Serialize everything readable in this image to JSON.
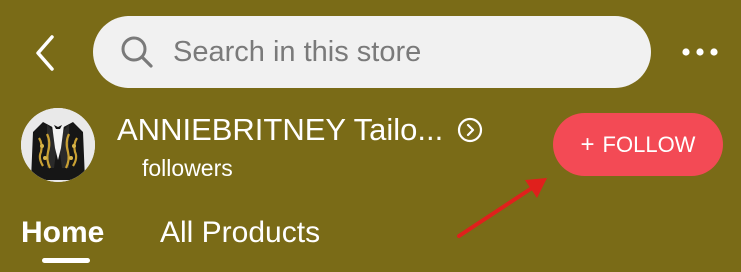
{
  "colors": {
    "background": "#7a6b17",
    "search_bg": "#f1f1f1",
    "follow_button": "#f34a55",
    "annotation_arrow": "#e0201c",
    "text": "#ffffff"
  },
  "header": {
    "back_icon": "chevron-left-icon",
    "search": {
      "placeholder": "Search in this store",
      "value": "",
      "icon": "search-icon"
    },
    "more_icon": "more-dots-icon"
  },
  "store": {
    "avatar_icon": "tuxedo-jacket-avatar",
    "name": "ANNIEBRITNEY Tailo...",
    "name_arrow_icon": "circle-chevron-right-icon",
    "followers_label": "followers",
    "follow_button": {
      "plus": "+",
      "label": "FOLLOW"
    }
  },
  "tabs": [
    {
      "label": "Home",
      "active": true
    },
    {
      "label": "All Products",
      "active": false
    }
  ]
}
